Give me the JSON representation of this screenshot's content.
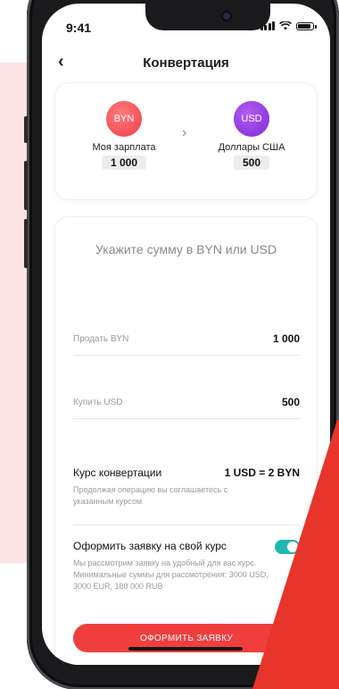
{
  "status_bar": {
    "time": "9:41"
  },
  "nav": {
    "title": "Конвертация"
  },
  "from_currency": {
    "code": "BYN",
    "label": "Моя зарплата",
    "amount": "1 000"
  },
  "to_currency": {
    "code": "USD",
    "label": "Доллары США",
    "amount": "500"
  },
  "form": {
    "prompt": "Укажите сумму в BYN или USD",
    "sell_label": "Продать BYN",
    "sell_value": "1 000",
    "buy_label": "Купить USD",
    "buy_value": "500",
    "rate_title": "Курс конвертации",
    "rate_value": "1 USD = 2 BYN",
    "rate_note": "Продолжая операцию вы соглашаетесь с указанным курсом",
    "own_rate_title": "Оформить заявку на свой курс",
    "own_rate_enabled": true,
    "own_rate_note": "Мы рассмотрим заявку на удобный для вас курс. Минимальные суммы для рассмотрения: 3000 USD, 3000 EUR, 180 000 RUB",
    "submit_label": "ОФОРМИТЬ ЗАЯВКУ"
  },
  "colors": {
    "accent_red": "#f03e3e",
    "toggle_teal": "#1fb7b2",
    "byn_circle": "#f03e4a",
    "usd_circle": "#7a2bd8",
    "background_pink": "#fde3e3"
  }
}
